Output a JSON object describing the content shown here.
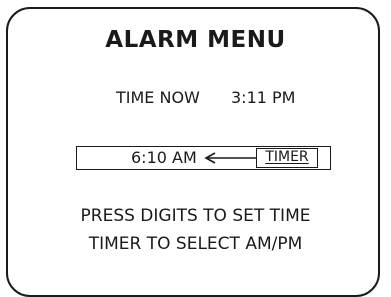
{
  "menu": {
    "title": "ALARM MENU"
  },
  "clock": {
    "label": "TIME NOW",
    "value": "3:11 PM"
  },
  "alarm": {
    "value": "6:10 AM",
    "arrow_icon": "arrow-left-icon",
    "timer_label": "TIMER"
  },
  "instructions": [
    "PRESS DIGITS TO SET TIME",
    "TIMER TO SELECT AM/PM"
  ]
}
